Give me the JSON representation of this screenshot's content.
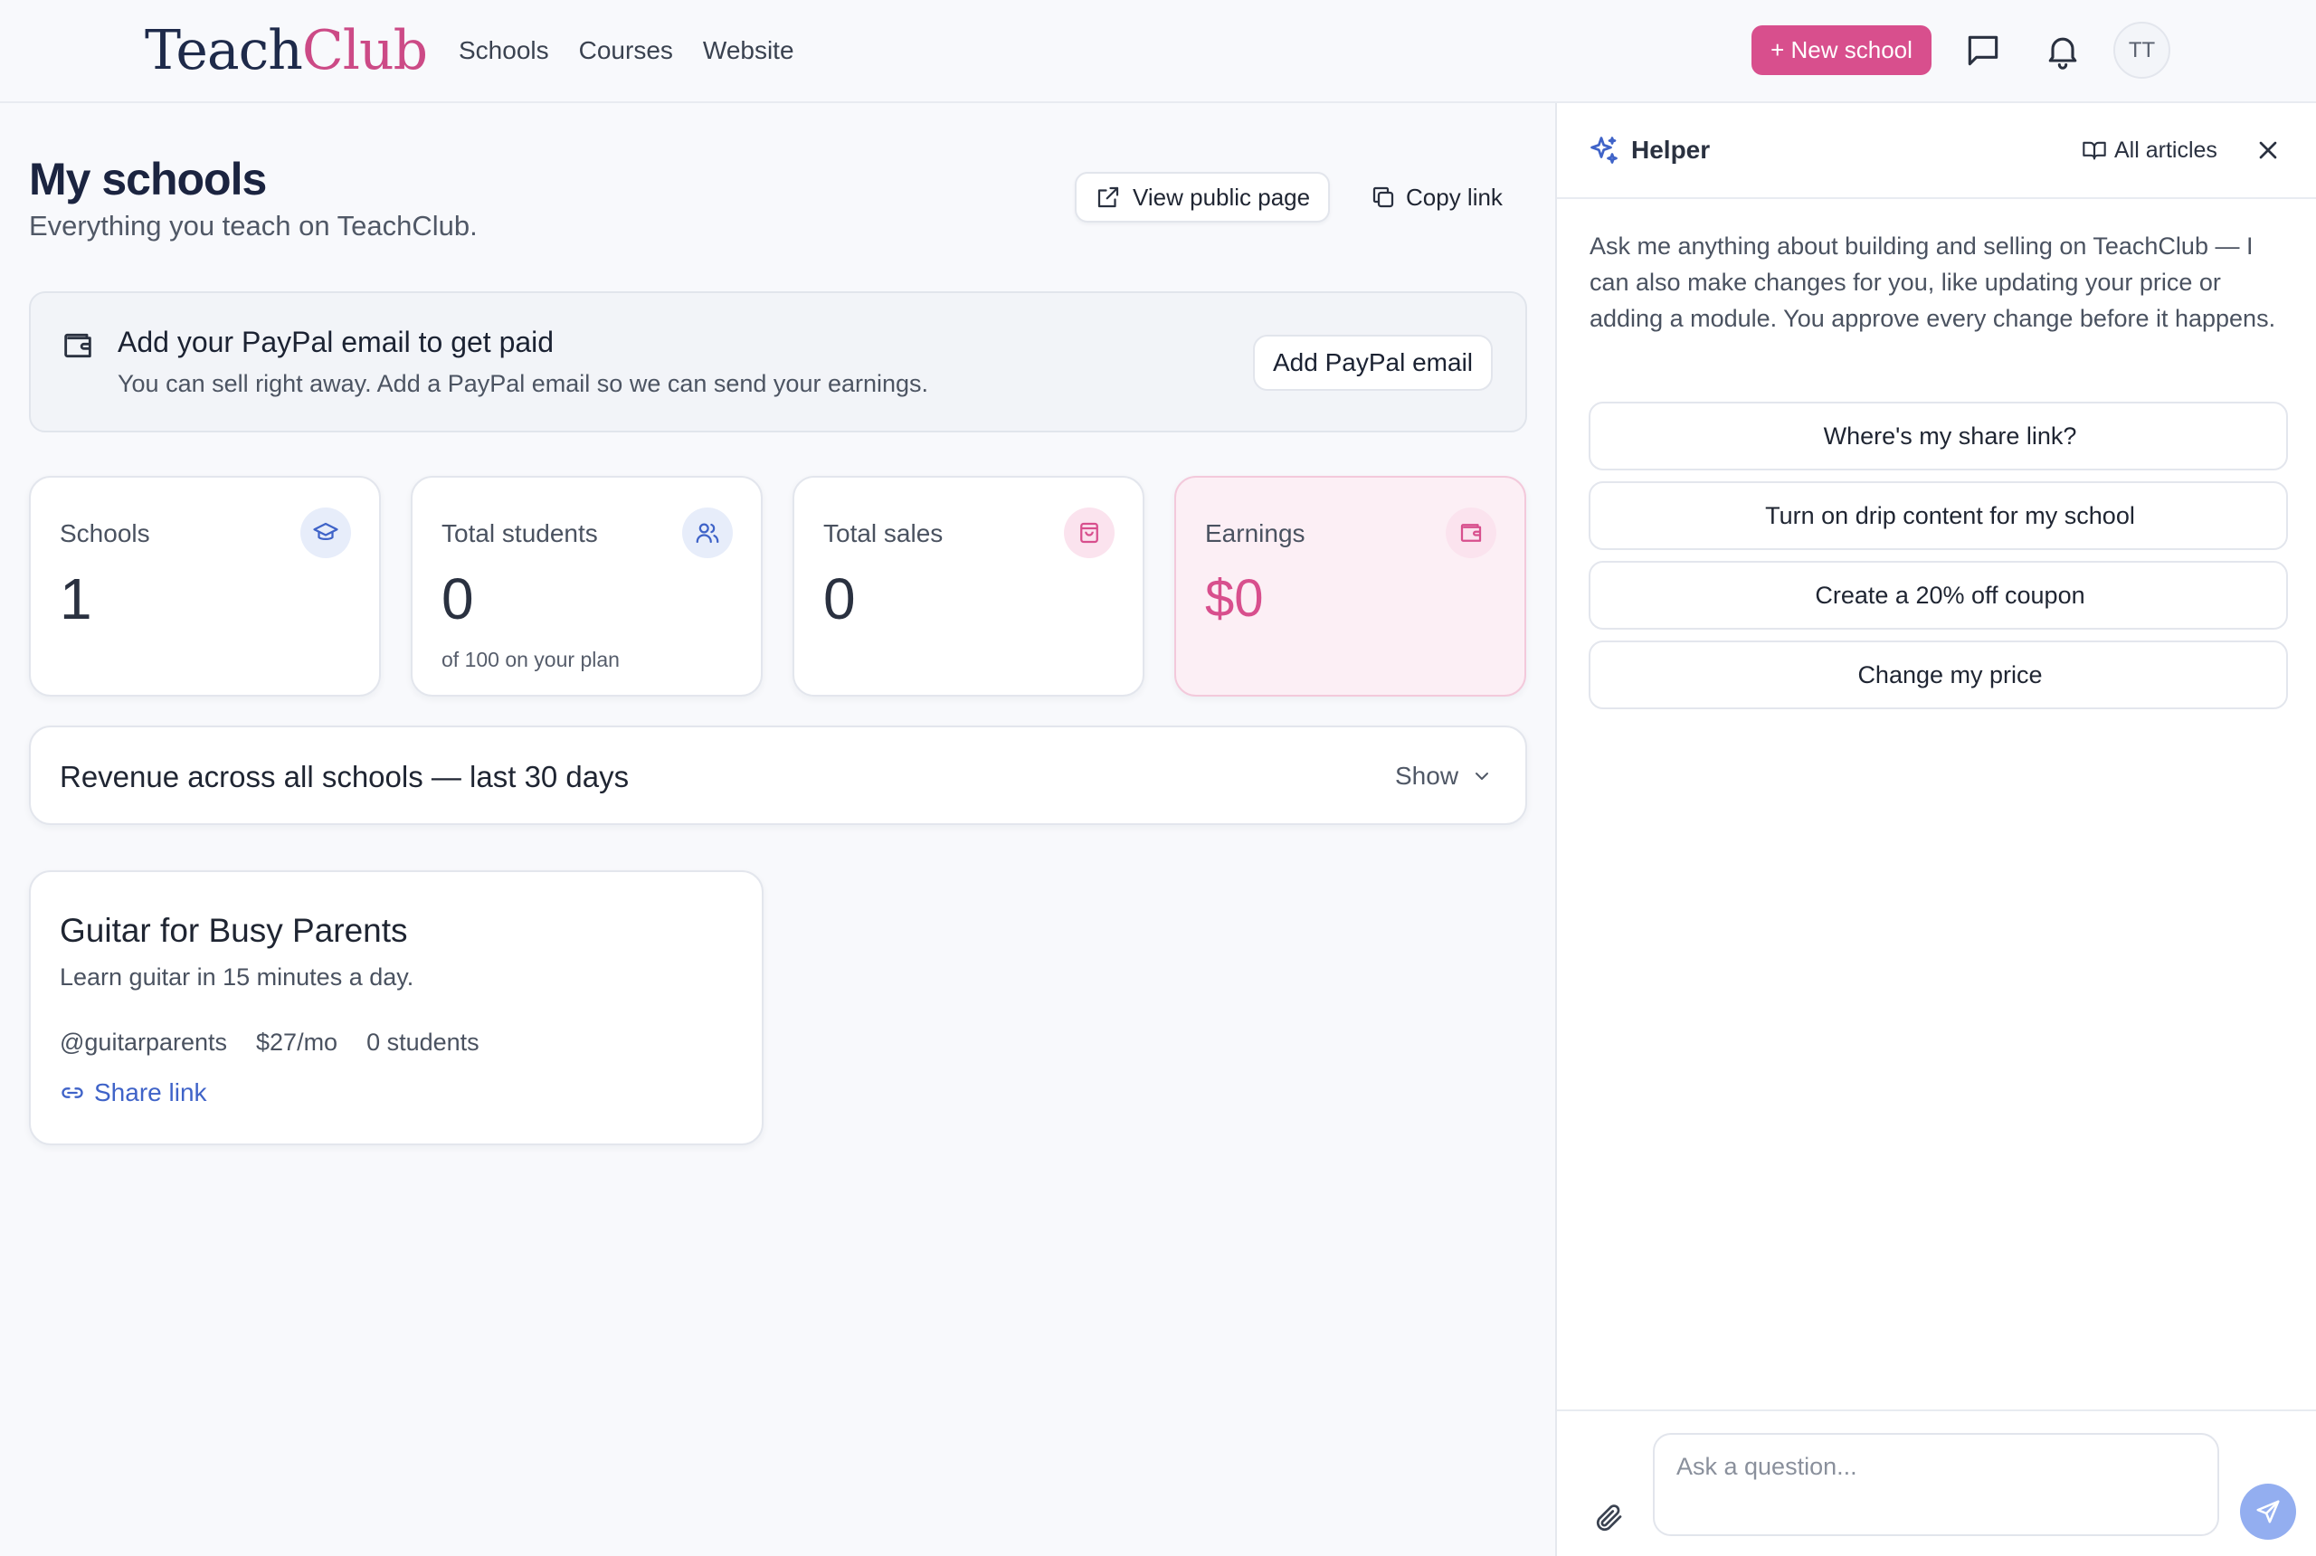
{
  "brand": {
    "part1": "Teach",
    "part2": "Club"
  },
  "nav": {
    "items": [
      {
        "label": "Schools"
      },
      {
        "label": "Courses"
      },
      {
        "label": "Website"
      }
    ]
  },
  "header": {
    "new_school_label": "+ New school",
    "avatar_initials": "TT",
    "icons": [
      "message-square-icon",
      "bell-icon"
    ]
  },
  "main": {
    "title": "My schools",
    "subtitle": "Everything you teach on TeachClub.",
    "view_public_label": "View public page",
    "copy_link_label": "Copy link"
  },
  "banner": {
    "title": "Add your PayPal email to get paid",
    "text": "You can sell right away. Add a PayPal email so we can send your earnings.",
    "button_label": "Add PayPal email",
    "icon": "wallet-icon"
  },
  "stats": [
    {
      "label": "Schools",
      "value": "1",
      "note": "",
      "icon": "graduation-cap-icon"
    },
    {
      "label": "Total students",
      "value": "0",
      "note": "of 100 on your plan",
      "icon": "users-icon"
    },
    {
      "label": "Total sales",
      "value": "0",
      "note": "",
      "icon": "shopping-bag-icon"
    },
    {
      "label": "Earnings",
      "value": "$0",
      "note": "",
      "icon": "wallet-icon"
    }
  ],
  "revenue": {
    "title": "Revenue across all schools — last 30 days",
    "toggle_label": "Show"
  },
  "course": {
    "title": "Guitar for Busy Parents",
    "description": "Learn guitar in 15 minutes a day.",
    "handle": "@guitarparents",
    "price": "$27/mo",
    "students": "0 students",
    "share_label": "Share link"
  },
  "helper": {
    "title": "Helper",
    "articles_label": "All articles",
    "intro": "Ask me anything about building and selling on TeachClub — I can also make changes for you, like updating your price or adding a module. You approve every change before it happens.",
    "suggestions": [
      {
        "label": "Where's my share link?"
      },
      {
        "label": "Turn on drip content for my school"
      },
      {
        "label": "Create a 20% off coupon"
      },
      {
        "label": "Change my price"
      }
    ],
    "input_placeholder": "Ask a question..."
  },
  "colors": {
    "accent_pink": "#d84f8d",
    "link_blue": "#3f63c8",
    "send_button": "#93aef0",
    "brand_navy": "#1e2a4a"
  }
}
